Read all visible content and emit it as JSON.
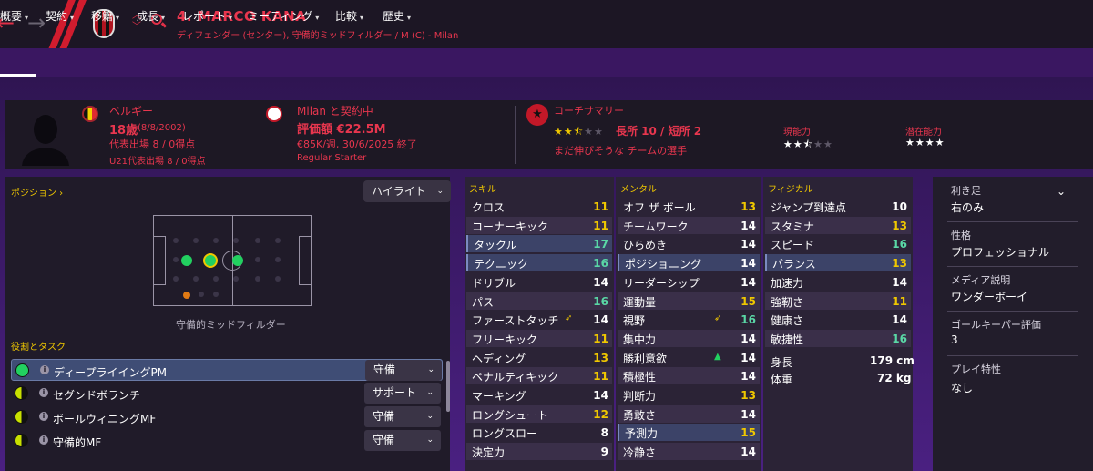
{
  "colors": {
    "accent_red": "#e8364e",
    "yellow_header": "#f0c800",
    "value_green": "#5ad8a6",
    "value_yellow": "#f0c800",
    "green_arrow": "#22d060"
  },
  "header": {
    "player_name": "4. MARCO KANA",
    "subtitle": "ディフェンダー (センター), 守備的ミッドフィルダー / M (C) - Milan",
    "icons": [
      "back-arrow-icon",
      "forward-arrow-icon",
      "club-crest-icon",
      "up-down-chevron-icon",
      "search-icon"
    ]
  },
  "nav": {
    "tabs": [
      {
        "label": "概要"
      },
      {
        "label": "契約"
      },
      {
        "label": "移籍"
      },
      {
        "label": "成長"
      },
      {
        "label": "レポート"
      },
      {
        "label": "ミーティング"
      },
      {
        "label": "比較"
      },
      {
        "label": "歴史"
      }
    ],
    "active_index": 0
  },
  "profile": {
    "nation": "ベルギー",
    "age": "18歳",
    "dob": "(8/8/2002)",
    "caps": "代表出場 8 / 0得点",
    "u21_caps": "U21代表出場 8 / 0得点",
    "contract": "Milan と契約中",
    "value": "評価額 €22.5M",
    "wage": "€85K/週, 30/6/2025 終了",
    "squad_status": "Regular Starter",
    "coach_title": "コーチサマリー",
    "coach_stars": 2.5,
    "coach_stars_text": "長所 10 / 短所 2",
    "coach_comment": "まだ伸びそうな チームの選手",
    "ca_label": "現能力",
    "ca_stars": 2.5,
    "pa_label": "潜在能力",
    "pa_stars": 4
  },
  "positions": {
    "title": "ポジション",
    "dropdown": "ハイライト",
    "position_label": "守備的ミッドフィルダー"
  },
  "roles": {
    "title": "役割とタスク",
    "items": [
      {
        "name": "ディープライイングPM",
        "duty": "守備",
        "icon": "full"
      },
      {
        "name": "セグンドボランチ",
        "duty": "サポート",
        "icon": "half"
      },
      {
        "name": "ボールウィニングMF",
        "duty": "守備",
        "icon": "half"
      },
      {
        "name": "守備的MF",
        "duty": "守備",
        "icon": "half"
      }
    ]
  },
  "skills": {
    "title": "スキル",
    "items": [
      {
        "name": "クロス",
        "value": "11",
        "style": "y",
        "hl": false
      },
      {
        "name": "コーナーキック",
        "value": "11",
        "style": "y",
        "hl": false
      },
      {
        "name": "タックル",
        "value": "17",
        "style": "g",
        "hl": true
      },
      {
        "name": "テクニック",
        "value": "16",
        "style": "g",
        "hl": true
      },
      {
        "name": "ドリブル",
        "value": "14",
        "style": "w",
        "hl": false
      },
      {
        "name": "パス",
        "value": "16",
        "style": "g",
        "hl": false
      },
      {
        "name": "ファーストタッチ",
        "value": "14",
        "style": "w",
        "hl": false,
        "arrow": "yellow"
      },
      {
        "name": "フリーキック",
        "value": "11",
        "style": "y",
        "hl": false
      },
      {
        "name": "ヘディング",
        "value": "13",
        "style": "y",
        "hl": false
      },
      {
        "name": "ペナルティキック",
        "value": "11",
        "style": "y",
        "hl": false
      },
      {
        "name": "マーキング",
        "value": "14",
        "style": "w",
        "hl": false
      },
      {
        "name": "ロングシュート",
        "value": "12",
        "style": "y",
        "hl": false
      },
      {
        "name": "ロングスロー",
        "value": "8",
        "style": "w",
        "hl": false
      },
      {
        "name": "決定力",
        "value": "9",
        "style": "w",
        "hl": false
      }
    ]
  },
  "mental": {
    "title": "メンタル",
    "items": [
      {
        "name": "オフ ザ ボール",
        "value": "13",
        "style": "y",
        "hl": false
      },
      {
        "name": "チームワーク",
        "value": "14",
        "style": "w",
        "hl": false
      },
      {
        "name": "ひらめき",
        "value": "14",
        "style": "w",
        "hl": false
      },
      {
        "name": "ポジショニング",
        "value": "14",
        "style": "w",
        "hl": true
      },
      {
        "name": "リーダーシップ",
        "value": "14",
        "style": "w",
        "hl": false
      },
      {
        "name": "運動量",
        "value": "15",
        "style": "y",
        "hl": false
      },
      {
        "name": "視野",
        "value": "16",
        "style": "g",
        "hl": false,
        "arrow": "yellow"
      },
      {
        "name": "集中力",
        "value": "14",
        "style": "w",
        "hl": false
      },
      {
        "name": "勝利意欲",
        "value": "14",
        "style": "w",
        "hl": false,
        "arrow": "green"
      },
      {
        "name": "積極性",
        "value": "14",
        "style": "w",
        "hl": false
      },
      {
        "name": "判断力",
        "value": "13",
        "style": "y",
        "hl": false
      },
      {
        "name": "勇敢さ",
        "value": "14",
        "style": "w",
        "hl": false
      },
      {
        "name": "予測力",
        "value": "15",
        "style": "y",
        "hl": true
      },
      {
        "name": "冷静さ",
        "value": "14",
        "style": "w",
        "hl": false
      }
    ]
  },
  "physical": {
    "title": "フィジカル",
    "items": [
      {
        "name": "ジャンプ到達点",
        "value": "10",
        "style": "w",
        "hl": false
      },
      {
        "name": "スタミナ",
        "value": "13",
        "style": "y",
        "hl": false
      },
      {
        "name": "スピード",
        "value": "16",
        "style": "g",
        "hl": false
      },
      {
        "name": "バランス",
        "value": "13",
        "style": "y",
        "hl": true
      },
      {
        "name": "加速力",
        "value": "14",
        "style": "w",
        "hl": false
      },
      {
        "name": "強靭さ",
        "value": "11",
        "style": "y",
        "hl": false
      },
      {
        "name": "健康さ",
        "value": "14",
        "style": "w",
        "hl": false
      },
      {
        "name": "敏捷性",
        "value": "16",
        "style": "g",
        "hl": false
      }
    ],
    "height_label": "身長",
    "height": "179 cm",
    "weight_label": "体重",
    "weight": "72 kg"
  },
  "details": {
    "foot_label": "利き足",
    "foot": "右のみ",
    "personality_label": "性格",
    "personality": "プロフェッショナル",
    "media_label": "メディア説明",
    "media": "ワンダーボーイ",
    "gk_label": "ゴールキーパー評価",
    "gk": "3",
    "traits_label": "プレイ特性",
    "traits": "なし"
  }
}
